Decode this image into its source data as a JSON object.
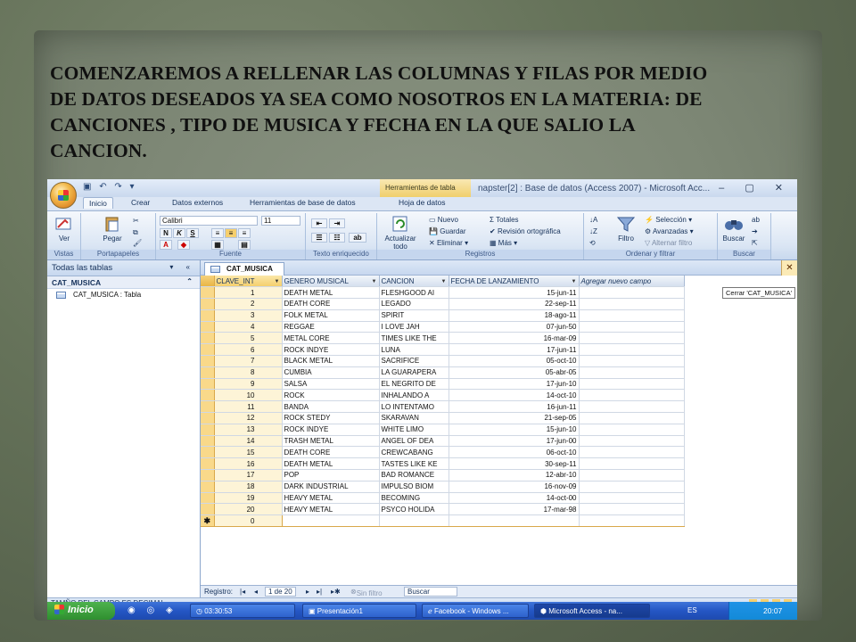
{
  "slide": {
    "headline": "COMENZAREMOS  A  RELLENAR LAS COLUMNAS Y FILAS POR MEDIO DE DATOS DESEADOS  YA SEA  COMO NOSOTROS EN LA MATERIA: DE CANCIONES , TIPO DE MUSICA Y FECHA EN LA QUE SALIO LA CANCION."
  },
  "window": {
    "context_tab": "Herramientas de tabla",
    "context_subtab": "Hoja de datos",
    "title": "napster[2] : Base de datos (Access 2007) - Microsoft Acc..."
  },
  "ribbon_tabs": [
    "Inicio",
    "Crear",
    "Datos externos",
    "Herramientas de base de datos"
  ],
  "ribbon": {
    "vistas": {
      "ver": "Ver",
      "label": "Vistas"
    },
    "portapapeles": {
      "pegar": "Pegar",
      "label": "Portapapeles"
    },
    "fuente": {
      "font": "Calibri",
      "size": "11",
      "label": "Fuente"
    },
    "texto": {
      "label": "Texto enriquecido"
    },
    "registros": {
      "actualizar": "Actualizar todo",
      "nuevo": "Nuevo",
      "guardar": "Guardar",
      "eliminar": "Eliminar",
      "totales": "Totales",
      "revision": "Revisión ortográfica",
      "mas": "Más",
      "label": "Registros"
    },
    "ordenar": {
      "filtro": "Filtro",
      "seleccion": "Selección",
      "avanzadas": "Avanzadas",
      "alternar": "Alternar filtro",
      "label": "Ordenar y filtrar"
    },
    "buscar": {
      "buscar": "Buscar",
      "label": "Buscar"
    }
  },
  "nav": {
    "header": "Todas las tablas",
    "group": "CAT_MUSICA",
    "item": "CAT_MUSICA : Tabla"
  },
  "doc": {
    "tab": "CAT_MUSICA",
    "tooltip": "Cerrar 'CAT_MUSICA'"
  },
  "table": {
    "headers": [
      "CLAVE_INT",
      "GENERO MUSICAL",
      "CANCION",
      "FECHA DE LANZAMIENTO",
      "Agregar nuevo campo"
    ],
    "rows": [
      [
        "1",
        "DEATH METAL",
        "FLESHGOOD AI",
        "15-jun-11"
      ],
      [
        "2",
        "DEATH CORE",
        "LEGADO",
        "22-sep-11"
      ],
      [
        "3",
        "FOLK METAL",
        "SPIRIT",
        "18-ago-11"
      ],
      [
        "4",
        "REGGAE",
        "I LOVE JAH",
        "07-jun-50"
      ],
      [
        "5",
        "METAL CORE",
        "TIMES LIKE THE",
        "16-mar-09"
      ],
      [
        "6",
        "ROCK INDYE",
        "LUNA",
        "17-jun-11"
      ],
      [
        "7",
        "BLACK METAL",
        "SACRIFICE",
        "05-oct-10"
      ],
      [
        "8",
        "CUMBIA",
        "LA GUARAPERA",
        "05-abr-05"
      ],
      [
        "9",
        "SALSA",
        "EL NEGRITO DE",
        "17-jun-10"
      ],
      [
        "10",
        "ROCK",
        "INHALANDO A",
        "14-oct-10"
      ],
      [
        "11",
        "BANDA",
        "LO INTENTAMO",
        "16-jun-11"
      ],
      [
        "12",
        "ROCK STEDY",
        "SKARAVAN",
        "21-sep-05"
      ],
      [
        "13",
        "ROCK INDYE",
        "WHITE LIMO",
        "15-jun-10"
      ],
      [
        "14",
        "TRASH METAL",
        "ANGEL OF DEA",
        "17-jun-00"
      ],
      [
        "15",
        "DEATH CORE",
        "CREWCABANG",
        "06-oct-10"
      ],
      [
        "16",
        "DEATH METAL",
        "TASTES LIKE KE",
        "30-sep-11"
      ],
      [
        "17",
        "POP",
        "BAD ROMANCE",
        "12-abr-10"
      ],
      [
        "18",
        "DARK INDUSTRIAL",
        "IMPULSO BIOM",
        "16-nov-09"
      ],
      [
        "19",
        "HEAVY METAL",
        "BECOMING",
        "14-oct-00"
      ],
      [
        "20",
        "HEAVY METAL",
        "PSYCO HOLIDA",
        "17-mar-98"
      ]
    ],
    "new_row_key": "0",
    "new_row_marker": "✱"
  },
  "recbar": {
    "label": "Registro:",
    "position": "1 de 20",
    "filter": "Sin filtro",
    "search": "Buscar"
  },
  "status": {
    "text": "TAMÑO DEL CAMPO ES DECIMAL"
  },
  "taskbar": {
    "start": "Inicio",
    "tasks": [
      "03:30:53",
      "Presentación1",
      "Facebook - Windows ...",
      "Microsoft Access - na..."
    ],
    "lang": "ES",
    "clock": "20:07"
  }
}
